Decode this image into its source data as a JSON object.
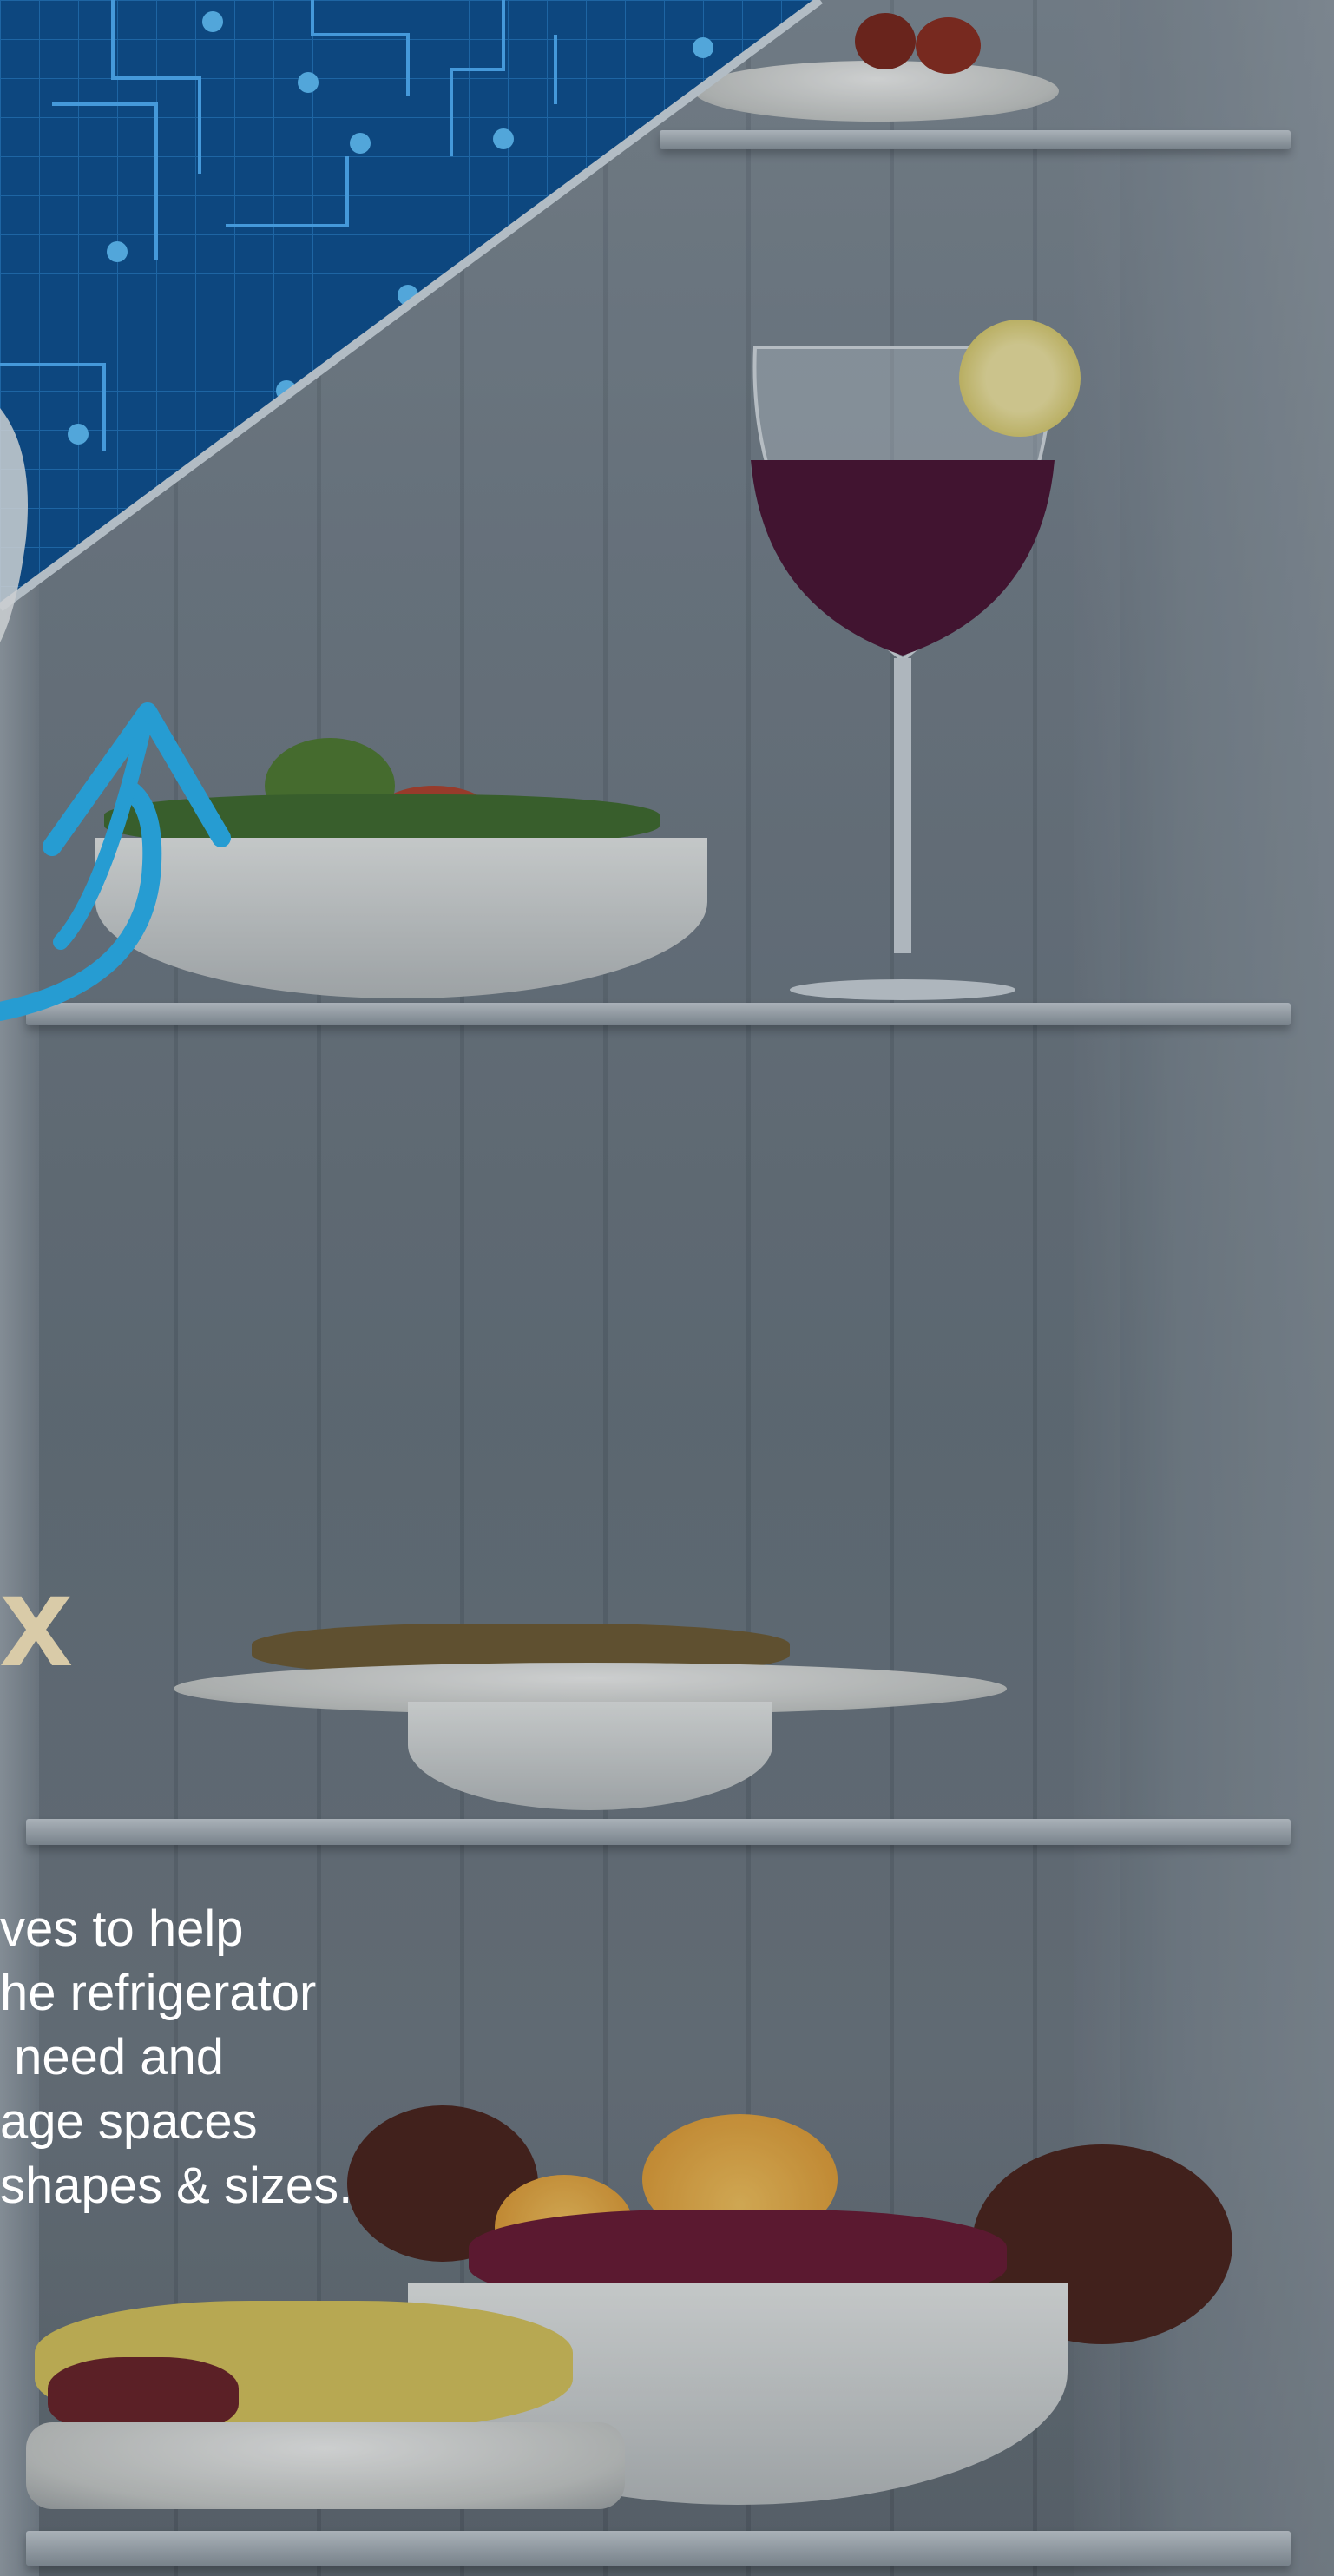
{
  "headline": {
    "letter": "x"
  },
  "body_text": {
    "lines": [
      "ves to help",
      "he refrigerator",
      " need and",
      "age spaces",
      "shapes & sizes."
    ]
  },
  "colors": {
    "circuit_bg": "#0a5fa8",
    "circuit_line": "#2f9cf0",
    "arrow": "#29b6f6",
    "headline": "#d9cba8",
    "text": "#ffffff"
  },
  "icons": {
    "arrow": "curved-up-arrow-icon"
  }
}
